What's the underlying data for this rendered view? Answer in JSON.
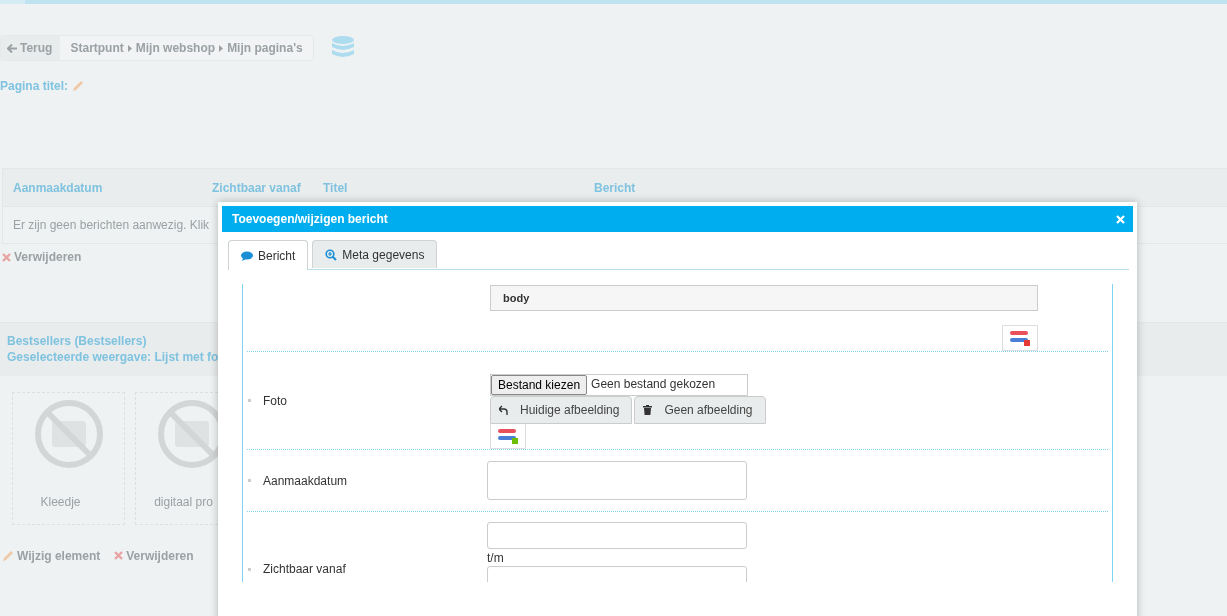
{
  "breadcrumb": {
    "back": "Terug",
    "items": [
      "Startpunt",
      "Mijn webshop",
      "Mijn pagina's"
    ]
  },
  "page_title_label": "Pagina titel:",
  "messages_table": {
    "columns": [
      "Aanmaakdatum",
      "Zichtbaar vanaf",
      "Titel",
      "Bericht"
    ],
    "empty_text": "Er zijn geen berichten aanwezig. Klik"
  },
  "delete_link": "Verwijderen",
  "widget": {
    "title": "Bestsellers (Bestsellers)",
    "view": "Geselecteerde weergave: Lijst met fo",
    "products": [
      {
        "name": "Kleedje"
      },
      {
        "name": "digitaal pro"
      }
    ],
    "actions": [
      "Wijzig element",
      "Verwijderen"
    ]
  },
  "dialog": {
    "title": "Toevoegen/wijzigen bericht",
    "tabs": [
      {
        "label": "Bericht",
        "selected": true
      },
      {
        "label": "Meta gegevens",
        "selected": false
      }
    ],
    "fields": [
      {
        "kind": "editor",
        "section": "body"
      },
      {
        "kind": "image",
        "label": "Foto",
        "file_button": "Bestand kiezen",
        "file_status": "Geen bestand gekozen",
        "buttons": [
          "Huidige afbeelding",
          "Geen afbeelding"
        ]
      },
      {
        "kind": "date",
        "label": "Aanmaakdatum"
      },
      {
        "kind": "range",
        "label": "Zichtbaar vanaf",
        "separator": "t/m"
      }
    ]
  }
}
